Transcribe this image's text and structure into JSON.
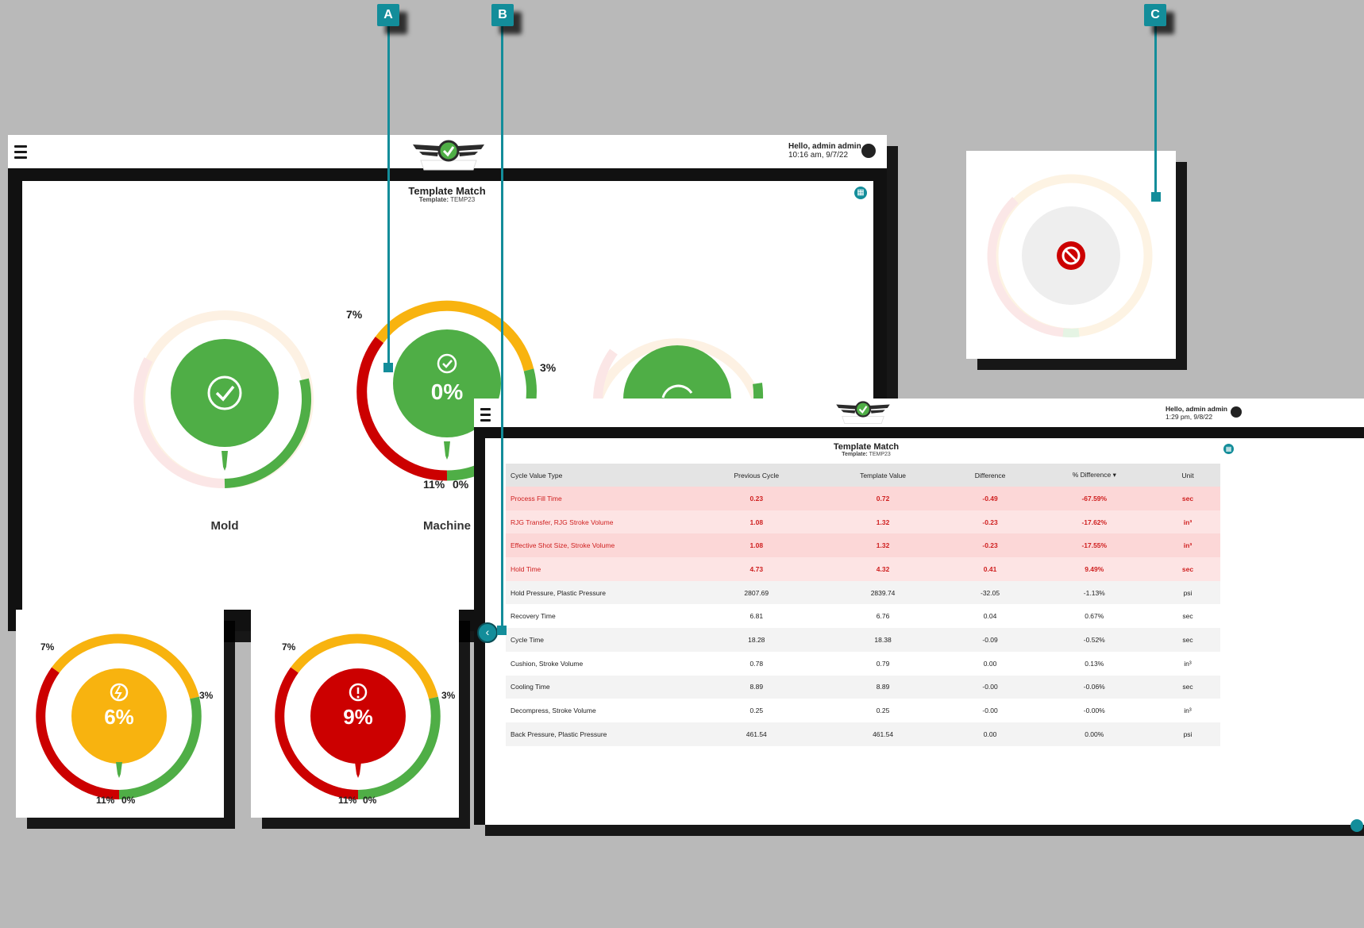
{
  "callouts": {
    "a": "A",
    "b": "B",
    "c": "C"
  },
  "colors": {
    "accent": "#138d9a",
    "green": "#4fae46",
    "amber": "#f8b30f",
    "red": "#cc0000"
  },
  "main_window": {
    "greeting": "Hello, admin admin",
    "datetime": "10:16 am, 9/7/22",
    "panel_title": "Template Match",
    "template_label": "Template:",
    "template_value": "TEMP23",
    "gauges": [
      {
        "label": "Mold",
        "status": "check"
      },
      {
        "label": "Machine",
        "status": "check",
        "value": "0%",
        "low_left": "7%",
        "right": "3%",
        "bottom_left": "11%",
        "bottom_right": "0%"
      },
      {
        "label": "",
        "status": "check"
      }
    ]
  },
  "inset_gauges": [
    {
      "icon": "lightning-icon",
      "value": "6%",
      "top_left": "7%",
      "right": "3%",
      "bottom_left": "11%",
      "bottom_right": "0%",
      "color": "#f8b30f"
    },
    {
      "icon": "exclamation-icon",
      "value": "9%",
      "top_left": "7%",
      "right": "3%",
      "bottom_left": "11%",
      "bottom_right": "0%",
      "color": "#cc0000"
    }
  ],
  "disabled_gauge": {
    "icon": "no-entry-icon"
  },
  "table_window": {
    "greeting": "Hello, admin admin",
    "datetime": "1:29 pm, 9/8/22",
    "panel_title": "Template Match",
    "template_label": "Template:",
    "template_value": "TEMP23",
    "columns": [
      "Cycle Value Type",
      "Previous Cycle",
      "Template Value",
      "Difference",
      "% Difference ▾",
      "Unit"
    ],
    "rows": [
      {
        "name": "Process Fill Time",
        "prev": "0.23",
        "tmpl": "0.72",
        "diff": "-0.49",
        "pct": "-67.59%",
        "unit": "sec",
        "flag": true
      },
      {
        "name": "RJG Transfer, RJG Stroke Volume",
        "prev": "1.08",
        "tmpl": "1.32",
        "diff": "-0.23",
        "pct": "-17.62%",
        "unit": "in³",
        "flag": true
      },
      {
        "name": "Effective Shot Size, Stroke Volume",
        "prev": "1.08",
        "tmpl": "1.32",
        "diff": "-0.23",
        "pct": "-17.55%",
        "unit": "in³",
        "flag": true
      },
      {
        "name": "Hold Time",
        "prev": "4.73",
        "tmpl": "4.32",
        "diff": "0.41",
        "pct": "9.49%",
        "unit": "sec",
        "flag": true
      },
      {
        "name": "Hold Pressure, Plastic Pressure",
        "prev": "2807.69",
        "tmpl": "2839.74",
        "diff": "-32.05",
        "pct": "-1.13%",
        "unit": "psi",
        "flag": false
      },
      {
        "name": "Recovery Time",
        "prev": "6.81",
        "tmpl": "6.76",
        "diff": "0.04",
        "pct": "0.67%",
        "unit": "sec",
        "flag": false
      },
      {
        "name": "Cycle Time",
        "prev": "18.28",
        "tmpl": "18.38",
        "diff": "-0.09",
        "pct": "-0.52%",
        "unit": "sec",
        "flag": false
      },
      {
        "name": "Cushion, Stroke Volume",
        "prev": "0.78",
        "tmpl": "0.79",
        "diff": "0.00",
        "pct": "0.13%",
        "unit": "in³",
        "flag": false
      },
      {
        "name": "Cooling Time",
        "prev": "8.89",
        "tmpl": "8.89",
        "diff": "-0.00",
        "pct": "-0.06%",
        "unit": "sec",
        "flag": false
      },
      {
        "name": "Decompress, Stroke Volume",
        "prev": "0.25",
        "tmpl": "0.25",
        "diff": "-0.00",
        "pct": "-0.00%",
        "unit": "in³",
        "flag": false
      },
      {
        "name": "Back Pressure, Plastic Pressure",
        "prev": "461.54",
        "tmpl": "461.54",
        "diff": "0.00",
        "pct": "0.00%",
        "unit": "psi",
        "flag": false
      }
    ]
  }
}
